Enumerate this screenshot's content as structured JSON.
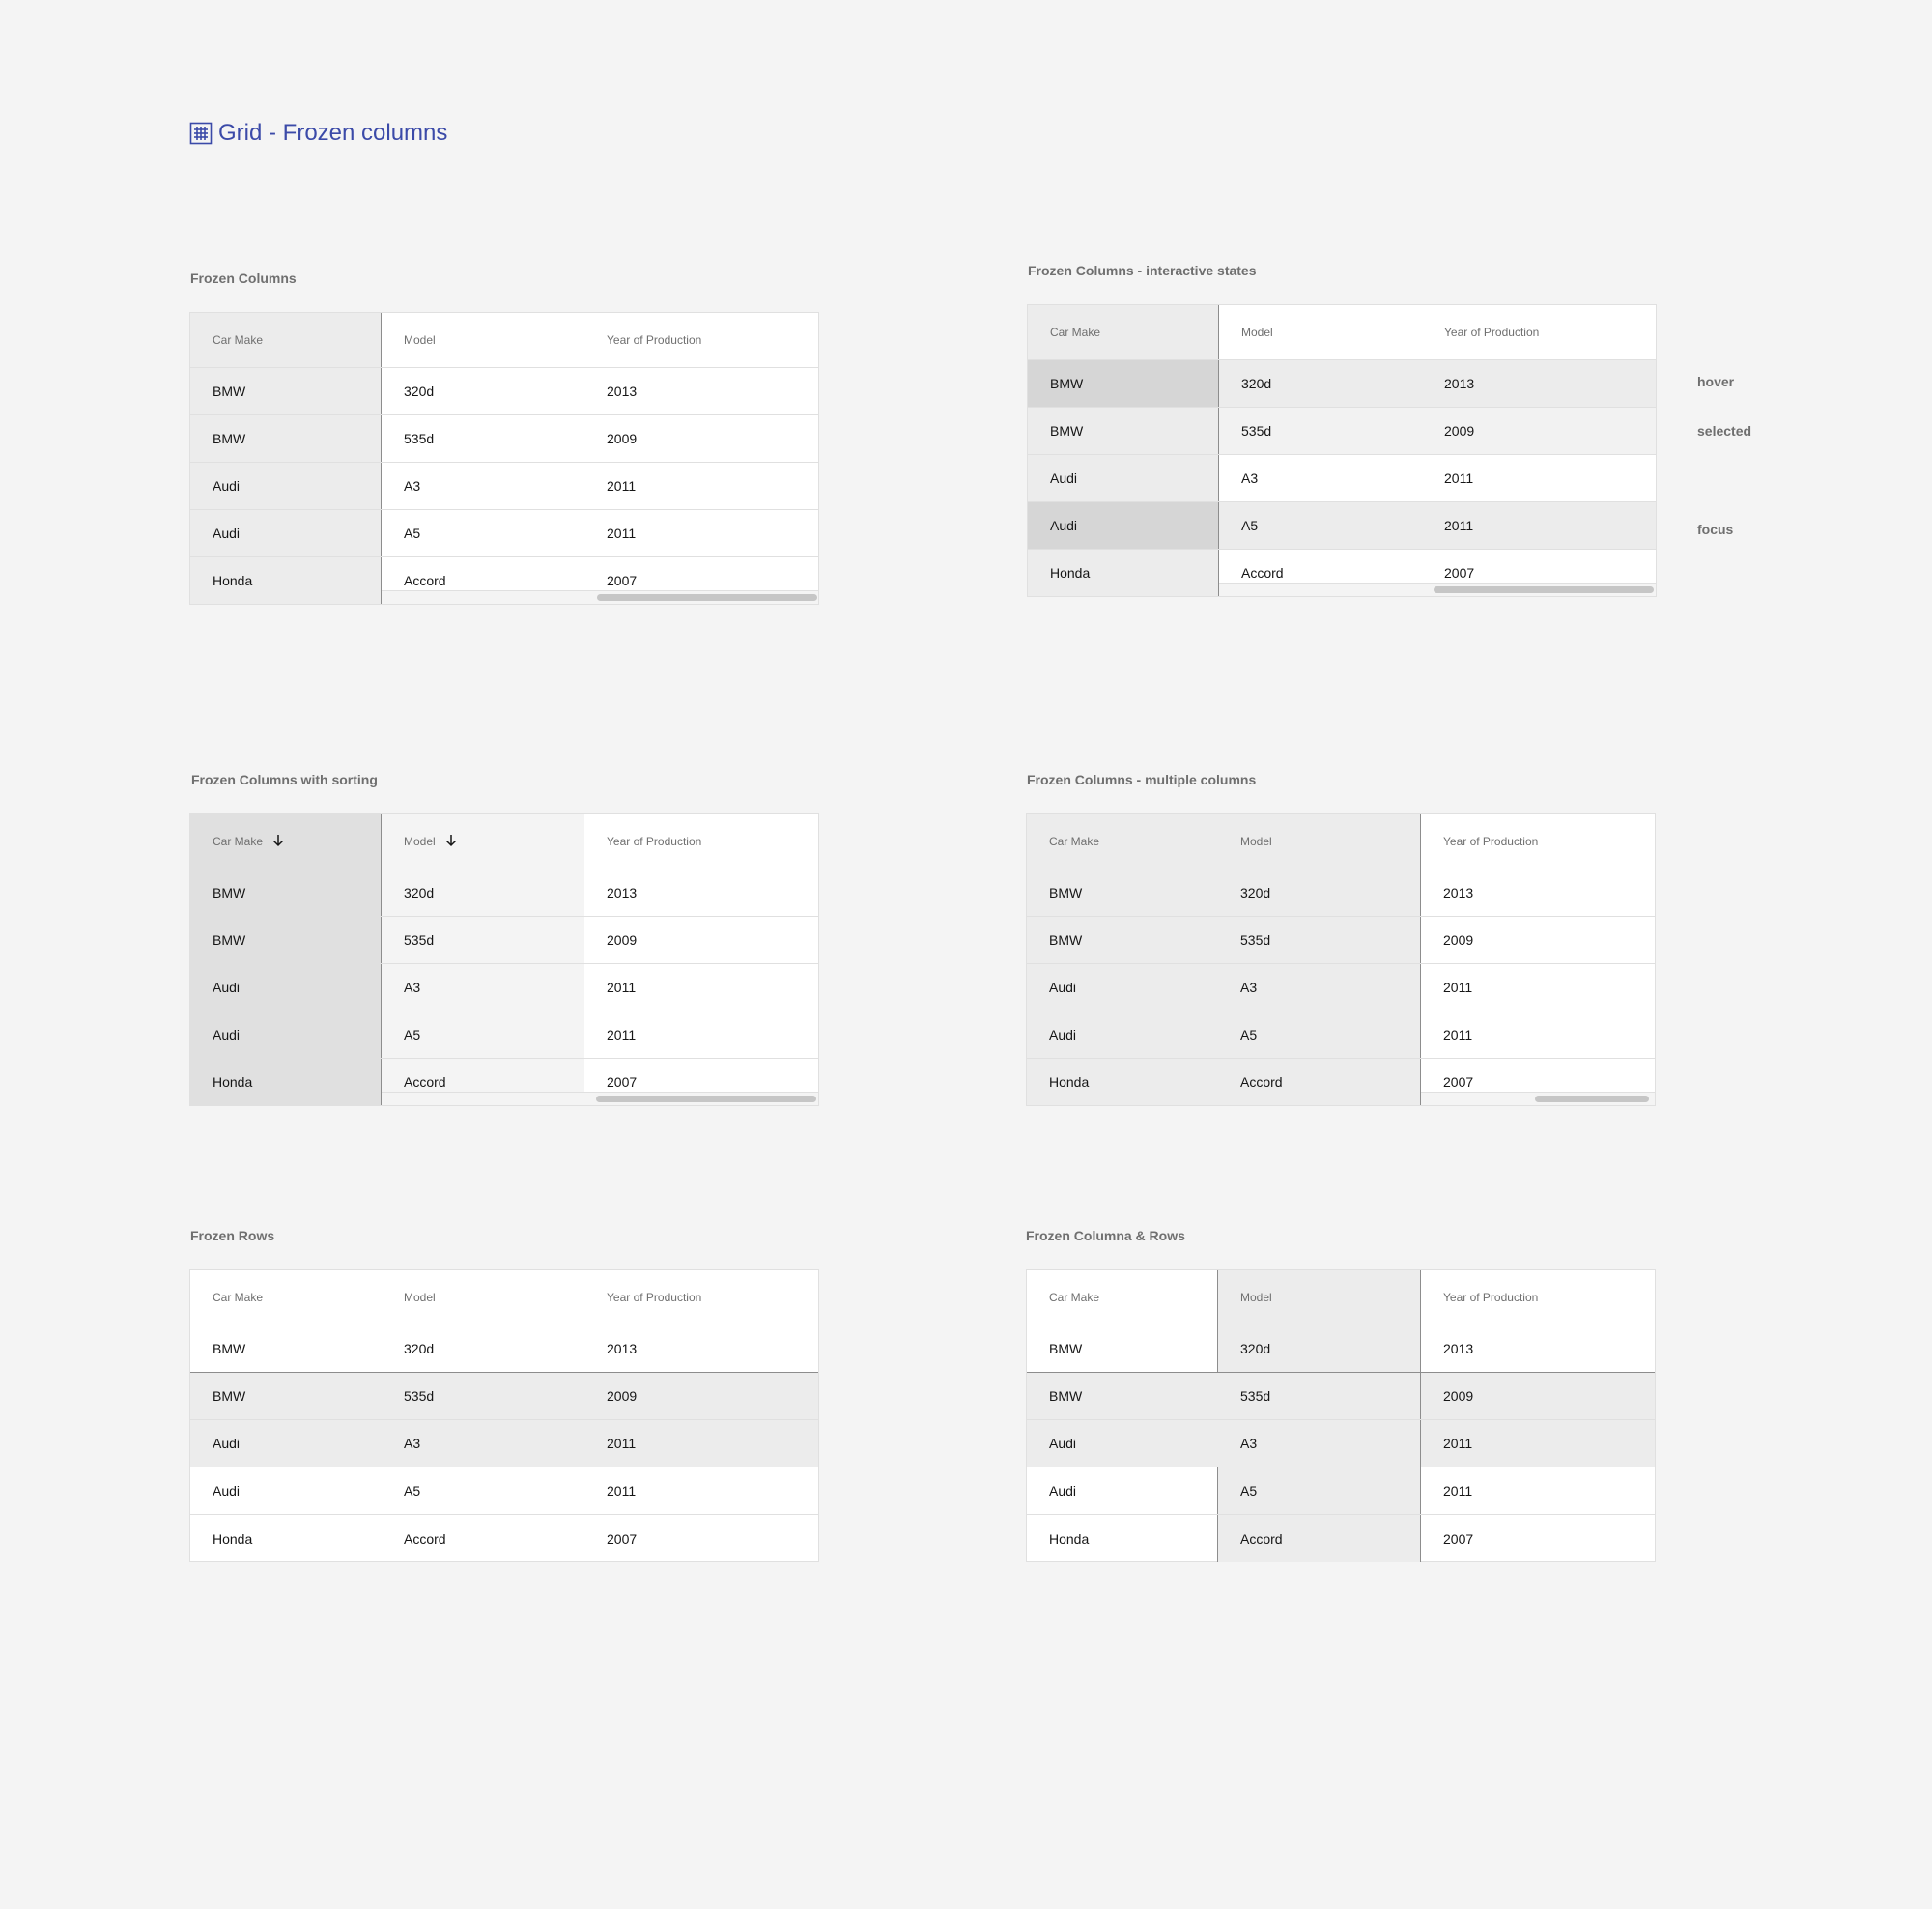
{
  "page": {
    "title": "Grid - Frozen columns",
    "accent": "#3b4aa8"
  },
  "columns": [
    "Car Make",
    "Model",
    "Year of Production"
  ],
  "rows": [
    [
      "BMW",
      "320d",
      "2013"
    ],
    [
      "BMW",
      "535d",
      "2009"
    ],
    [
      "Audi",
      "A3",
      "2011"
    ],
    [
      "Audi",
      "A5",
      "2011"
    ],
    [
      "Honda",
      "Accord",
      "2007"
    ]
  ],
  "sections": {
    "frozen_columns": "Frozen Columns",
    "interactive_states": "Frozen Columns - interactive states",
    "with_sorting": "Frozen Columns with sorting",
    "multiple_columns": "Frozen Columns - multiple columns",
    "frozen_rows": "Frozen Rows",
    "frozen_columns_rows": "Frozen Columna & Rows"
  },
  "states": {
    "hover": "hover",
    "selected": "selected",
    "focus": "focus"
  },
  "sort_icon": "arrow-down-icon",
  "icons": {
    "title_icon": "grid-icon"
  }
}
